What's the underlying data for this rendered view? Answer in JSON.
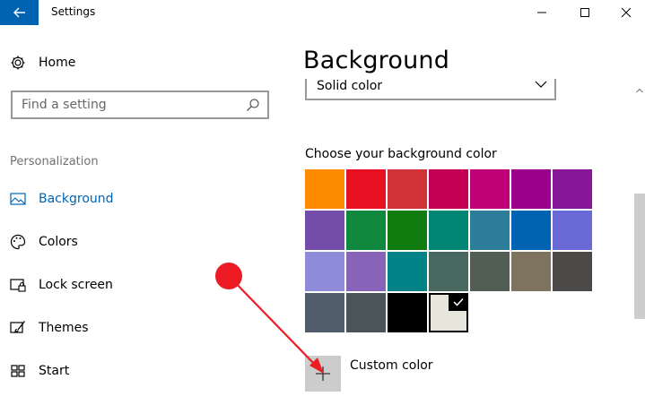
{
  "window": {
    "title": "Settings",
    "back_icon": "arrow-left-icon",
    "accent_color": "#0063b1"
  },
  "sidebar": {
    "home_label": "Home",
    "search_placeholder": "Find a setting",
    "section_header": "Personalization",
    "items": [
      {
        "label": "Background",
        "icon": "background-icon",
        "active": true
      },
      {
        "label": "Colors",
        "icon": "palette-icon",
        "active": false
      },
      {
        "label": "Lock screen",
        "icon": "lock-screen-icon",
        "active": false
      },
      {
        "label": "Themes",
        "icon": "themes-icon",
        "active": false
      },
      {
        "label": "Start",
        "icon": "start-icon",
        "active": false
      }
    ]
  },
  "main": {
    "title": "Background",
    "dropdown_value": "Solid color",
    "choose_label": "Choose your background color",
    "custom_color_label": "Custom color",
    "colors": [
      [
        "#ff8c00",
        "#e81123",
        "#d13438",
        "#c30052",
        "#bf0077",
        "#9a0089",
        "#881798"
      ],
      [
        "#744da9",
        "#10893e",
        "#107c10",
        "#018574",
        "#2d7d9a",
        "#0063b1",
        "#6b69d6"
      ],
      [
        "#8e8cd8",
        "#8764b8",
        "#038387",
        "#486860",
        "#525e54",
        "#7e735f",
        "#4c4a48"
      ],
      [
        "#515c6b",
        "#4a5459",
        "#000000",
        "#e6e6dc"
      ]
    ],
    "selected_color": "#e6e6dc"
  },
  "annotation": {
    "color": "#ed1c24"
  }
}
